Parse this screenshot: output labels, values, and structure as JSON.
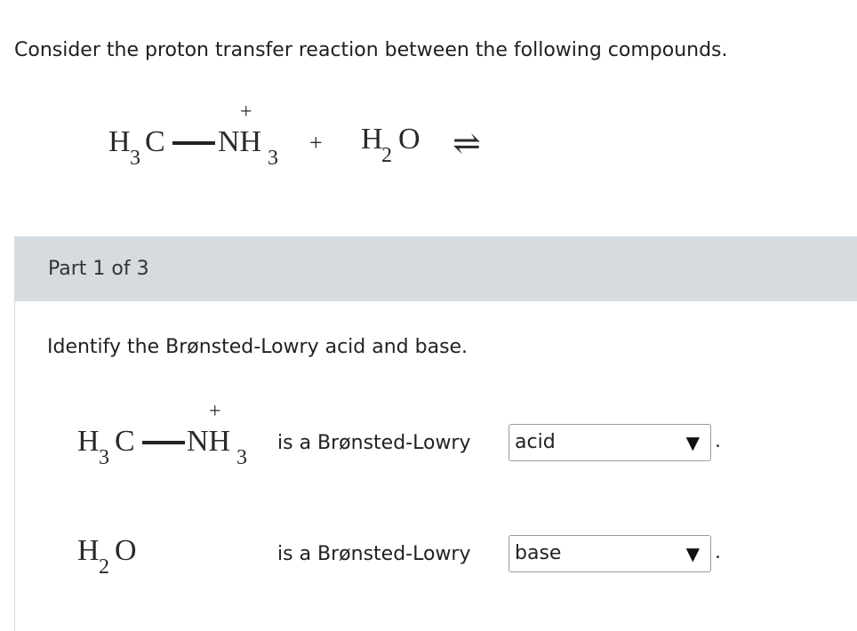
{
  "intro": "Consider the proton transfer reaction between the following compounds.",
  "reaction": {
    "reactant1": {
      "h": "H",
      "sub1": "3",
      "c": "C",
      "n": "NH",
      "sub2": "3",
      "charge": "+"
    },
    "plus": "+",
    "reactant2": {
      "h": "H",
      "sub": "2",
      "o": "O"
    },
    "arrow": "⇌"
  },
  "part": {
    "title": "Part 1 of 3"
  },
  "question": "Identify the Brønsted-Lowry acid and base.",
  "answers": [
    {
      "compound": {
        "h": "H",
        "sub1": "3",
        "c": "C",
        "n": "NH",
        "sub2": "3",
        "charge": "+"
      },
      "statement": "is a Brønsted-Lowry",
      "selected": "acid",
      "arrow": "▼",
      "period": "."
    },
    {
      "compound": {
        "h": "H",
        "sub": "2",
        "o": "O"
      },
      "statement": "is a Brønsted-Lowry",
      "selected": "base",
      "arrow": "▼",
      "period": "."
    }
  ]
}
